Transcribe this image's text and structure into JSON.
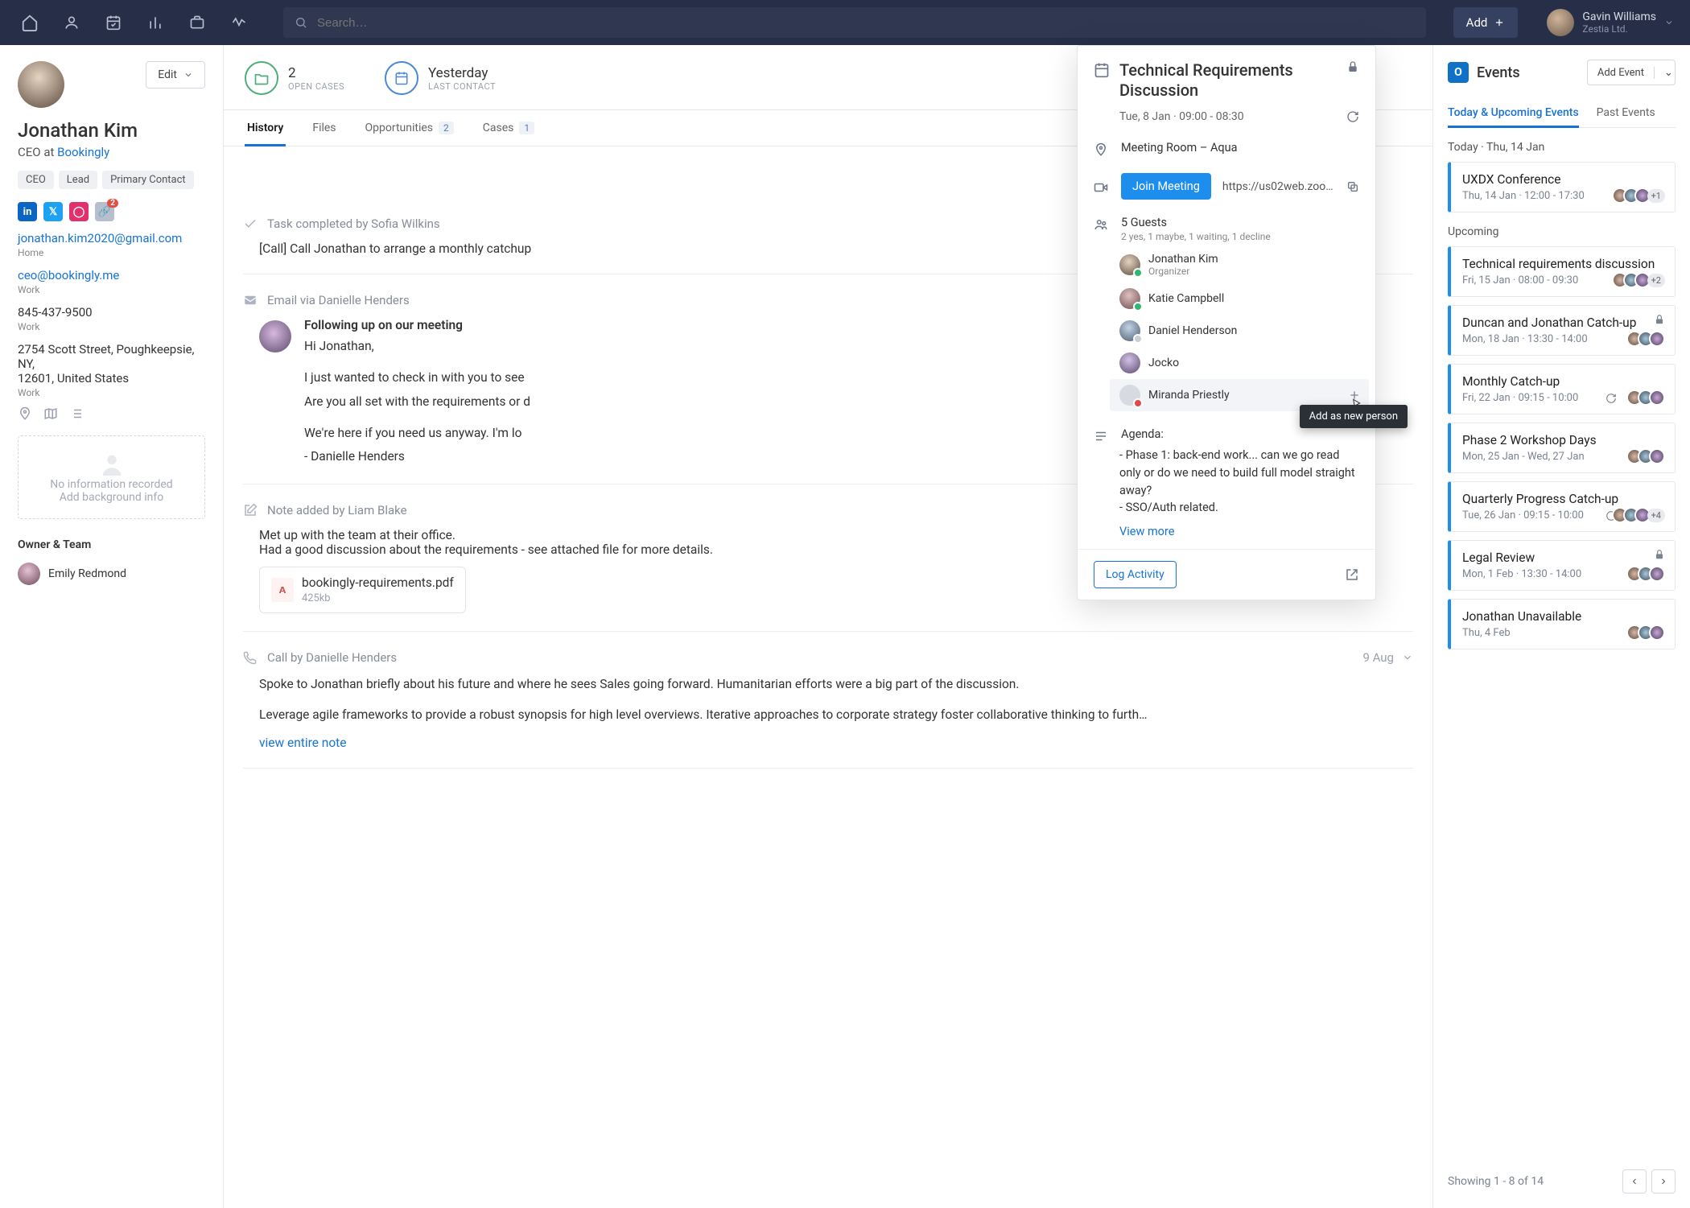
{
  "topbar": {
    "search_placeholder": "Search…",
    "add_label": "Add",
    "user_name": "Gavin Williams",
    "user_org": "Zestia Ltd."
  },
  "profile": {
    "edit_label": "Edit",
    "name": "Jonathan Kim",
    "role_prefix": "CEO at ",
    "role_company": "Bookingly",
    "tags": [
      "CEO",
      "Lead",
      "Primary Contact"
    ],
    "link_badge": "2",
    "email1": "jonathan.kim2020@gmail.com",
    "email1_lbl": "Home",
    "email2": "ceo@bookingly.me",
    "email2_lbl": "Work",
    "phone": "845-437-9500",
    "phone_lbl": "Work",
    "addr1": "2754 Scott Street, Poughkeepsie, NY,",
    "addr2": "12601, United States",
    "addr_lbl": "Work",
    "empty_title": "No information recorded",
    "empty_sub": "Add background info",
    "owner_title": "Owner & Team",
    "owner_name": "Emily Redmond"
  },
  "mid_header": {
    "stat1_n": "2",
    "stat1_l": "OPEN CASES",
    "stat2_n": "Yesterday",
    "stat2_l": "LAST CONTACT"
  },
  "tabs": {
    "history": "History",
    "files": "Files",
    "opps": "Opportunities",
    "opps_n": "2",
    "cases": "Cases",
    "cases_n": "1"
  },
  "feed": {
    "e1_head": "Task completed by Sofia Wilkins",
    "e1_body": "[Call] Call Jonathan to arrange a monthly catchup",
    "e2_head": "Email via Danielle Henders",
    "e2_subject": "Following up on our meeting",
    "e2_line1": "Hi Jonathan,",
    "e2_line2": "I just wanted to check in with you to see",
    "e2_line3": "Are you all set with the requirements or d",
    "e2_line4": "We're here if you need us anyway. I'm lo",
    "e2_line5": "- Danielle Henders",
    "e3_head": "Note added by Liam Blake",
    "e3_l1": "Met up with the team at their office.",
    "e3_l2": "Had a good discussion about the requirements - see attached file for more details.",
    "file_name": "bookingly-requirements.pdf",
    "file_size": "425kb",
    "e4_head": "Call by Danielle Henders",
    "e4_date": "9 Aug",
    "e4_p1": "Spoke to Jonathan briefly about his future and where he sees Sales going forward. Humanitarian efforts were a big part of the discussion.",
    "e4_p2": "Leverage agile frameworks to provide a robust synopsis for high level overviews. Iterative approaches to corporate strategy foster collaborative thinking to furth…",
    "view_note": "view entire note"
  },
  "popup": {
    "title": "Technical Requirements Discussion",
    "datetime": "Tue, 8 Jan · 09:00 - 08:30",
    "location": "Meeting Room – Aqua",
    "join": "Join Meeting",
    "zoom": "https://us02web.zoom.us/j/...",
    "guests_title": "5 Guests",
    "guests_sub": "2 yes, 1 maybe, 1 waiting, 1 decline",
    "g1_name": "Jonathan Kim",
    "g1_role": "Organizer",
    "g2": "Katie Campbell",
    "g3": "Daniel Henderson",
    "g4": "Jocko",
    "g5": "Miranda Priestly",
    "tooltip": "Add as new person",
    "agenda_label": "Agenda:",
    "agenda1": "- Phase 1: back-end work... can we go read only or do we need to build full model straight away?",
    "agenda2": "- SSO/Auth related.",
    "view_more": "View more",
    "log_activity": "Log Activity"
  },
  "events": {
    "title": "Events",
    "add": "Add Event",
    "tab1": "Today & Upcoming Events",
    "tab2": "Past Events",
    "today_label": "Today · Thu, 14 Jan",
    "upcoming_label": "Upcoming",
    "cards": [
      {
        "title": "UXDX Conference",
        "dt": "Thu, 14 Jan · 12:00 - 17:30",
        "more": "+1"
      },
      {
        "title": "Technical requirements discussion",
        "dt": "Fri, 15 Jan · 08:00 - 09:30",
        "more": "+2"
      },
      {
        "title": "Duncan and Jonathan Catch-up",
        "dt": "Mon, 18 Jan · 13:30 - 14:00",
        "lock": true
      },
      {
        "title": "Monthly Catch-up",
        "dt": "Fri, 22 Jan · 09:15 - 10:00",
        "recur": true
      },
      {
        "title": "Phase 2 Workshop Days",
        "dt": "Mon, 25 Jan - Wed, 27 Jan"
      },
      {
        "title": "Quarterly Progress Catch-up",
        "dt": "Tue, 26 Jan · 09:15 - 10:00",
        "recur": true,
        "more": "+4"
      },
      {
        "title": "Legal Review",
        "dt": "Mon, 1 Feb · 13:30 - 14:00",
        "lock": true
      },
      {
        "title": "Jonathan Unavailable",
        "dt": "Thu, 4 Feb"
      }
    ],
    "pager": "Showing 1 - 8 of 14"
  }
}
